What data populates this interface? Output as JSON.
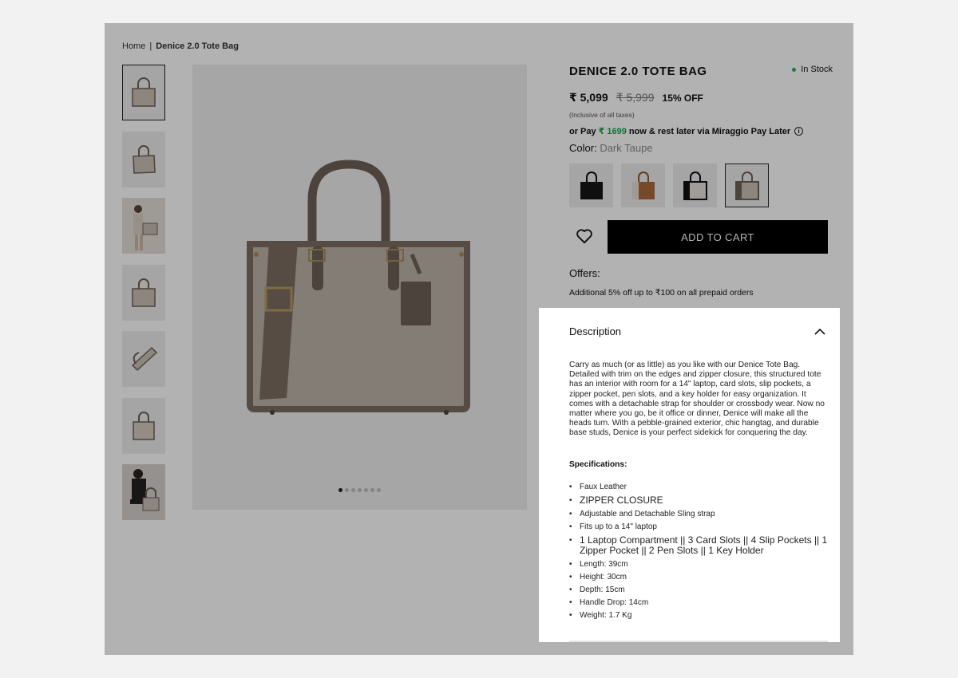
{
  "breadcrumb": {
    "home": "Home",
    "separator": "|",
    "current": "Denice 2.0 Tote Bag"
  },
  "gallery": {
    "thumbnails": [
      "bag-front",
      "bag-angled",
      "model-holding",
      "bag-front-plain",
      "bag-interior",
      "bag-side",
      "model-seated"
    ],
    "active_index": 0,
    "slide_count": 7,
    "active_slide": 0
  },
  "product": {
    "title": "DENICE 2.0 TOTE BAG",
    "stock": "In Stock",
    "price": "₹ 5,099",
    "mrp": "₹ 5,999",
    "discount": "15% OFF",
    "taxes_note": "(Inclusive of all taxes)",
    "paylater_prefix": "or Pay",
    "paylater_amount": "₹ 1699",
    "paylater_suffix": "now & rest later via Miraggio Pay Later",
    "color_label": "Color:",
    "color_value": "Dark Taupe",
    "swatches": [
      "Black",
      "Tan",
      "Black & Beige",
      "Dark Taupe"
    ],
    "selected_swatch": 3,
    "add_to_cart": "ADD TO CART",
    "offers_label": "Offers:",
    "offer_text": "Additional 5% off up to ₹100 on all prepaid orders"
  },
  "description": {
    "heading": "Description",
    "body": "Carry as much (or as little) as you like with our Denice Tote Bag. Detailed with trim on the edges and zipper closure, this structured tote has an interior with room for a 14\" laptop, card slots, slip pockets, a zipper pocket, pen slots, and a key holder for easy organization. It comes with a detachable strap for shoulder or crossbody wear. Now no matter where you go, be it office or dinner, Denice will make all the heads turn. With a pebble-grained exterior, chic hangtag, and durable base studs, Denice is your perfect sidekick for conquering the day.",
    "specs_title": "Specifications:",
    "specs": [
      "Faux Leather",
      "ZIPPER CLOSURE",
      "Adjustable and Detachable Sling strap",
      "Fits up to a 14\" laptop",
      "1 Laptop Compartment || 3 Card Slots || 4 Slip Pockets || 1 Zipper Pocket || 2 Pen Slots || 1 Key Holder",
      "Length: 39cm",
      "Height: 30cm",
      "Depth: 15cm",
      "Handle Drop: 14cm",
      "Weight: 1.7 Kg"
    ]
  },
  "colors": {
    "stock_green": "#1db45b",
    "price_green": "#18a34f",
    "bag_taupe": "#bdb3a8",
    "bag_trim": "#6e6156"
  }
}
